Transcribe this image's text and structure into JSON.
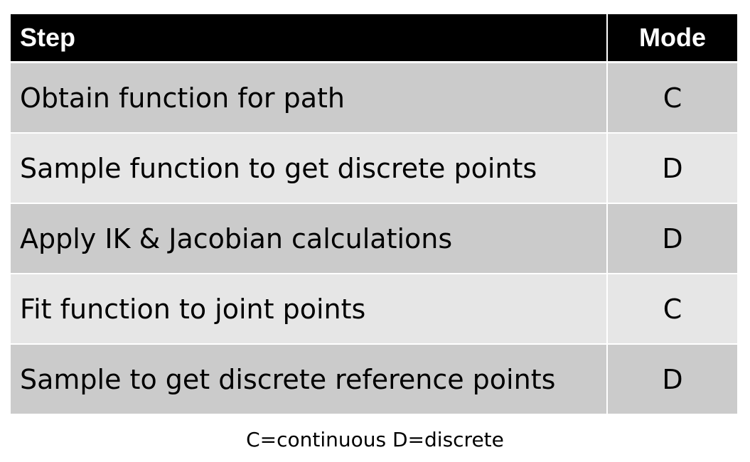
{
  "table": {
    "header": {
      "step": "Step",
      "mode": "Mode"
    },
    "rows": [
      {
        "step": "Obtain function for path",
        "mode": "C"
      },
      {
        "step": "Sample function to get discrete points",
        "mode": "D"
      },
      {
        "step": "Apply IK & Jacobian calculations",
        "mode": "D"
      },
      {
        "step": "Fit function to joint points",
        "mode": "C"
      },
      {
        "step": "Sample to get discrete reference points",
        "mode": "D"
      }
    ]
  },
  "legend": "C=continuous D=discrete",
  "colors": {
    "header_bg": "#000000",
    "header_text": "#ffffff",
    "row_dark": "#cbcbcb",
    "row_light": "#e6e6e6"
  }
}
